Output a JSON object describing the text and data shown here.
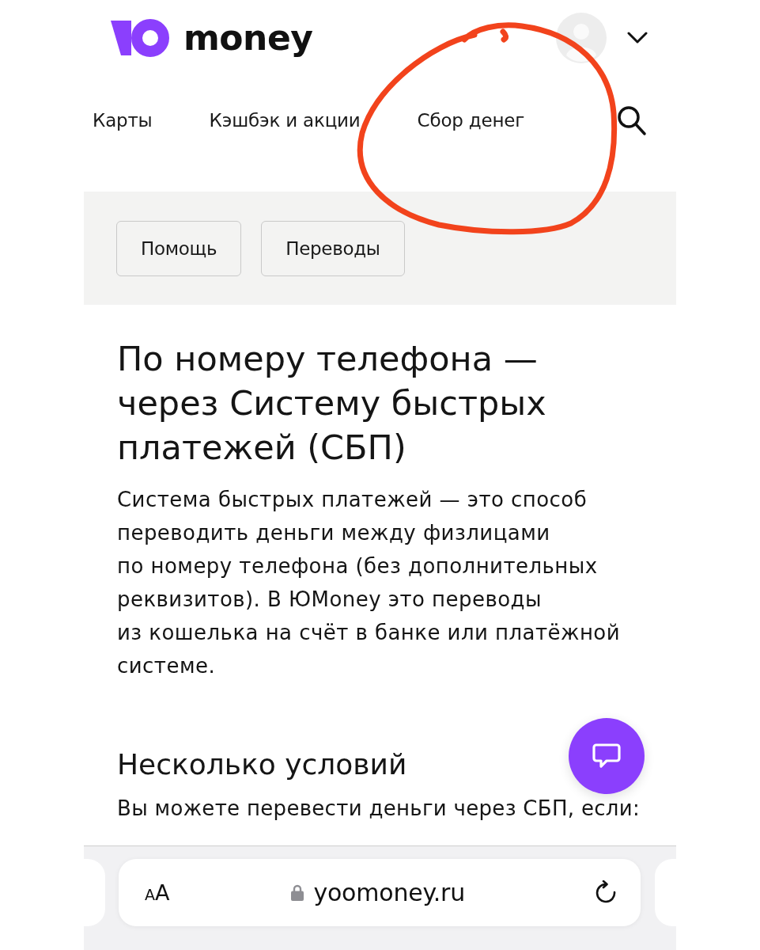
{
  "header": {
    "logo_text": "money"
  },
  "nav": {
    "items": [
      "Карты",
      "Кэшбэк и акции",
      "Сбор денег"
    ]
  },
  "quick_links": [
    "Помощь",
    "Переводы"
  ],
  "article": {
    "title": "По номеру телефона —\nчерез Систему быстрых\nплатежей (СБП)",
    "intro": "Система быстрых платежей  — это способ\nпереводить деньги между физлицами\nпо номеру телефона (без дополнительных\nреквизитов). В ЮMoney это переводы\nиз кошелька на счёт в банке или платёжной\nсистеме.",
    "subtitle": "Несколько условий",
    "conditions_lead": "Вы можете перевести деньги через СБП, если:"
  },
  "annotation": {
    "kind": "circle"
  },
  "browser_bar": {
    "text_size_button": {
      "small": "A",
      "large": "A"
    },
    "secure": true,
    "url": "yoomoney.ru"
  }
}
